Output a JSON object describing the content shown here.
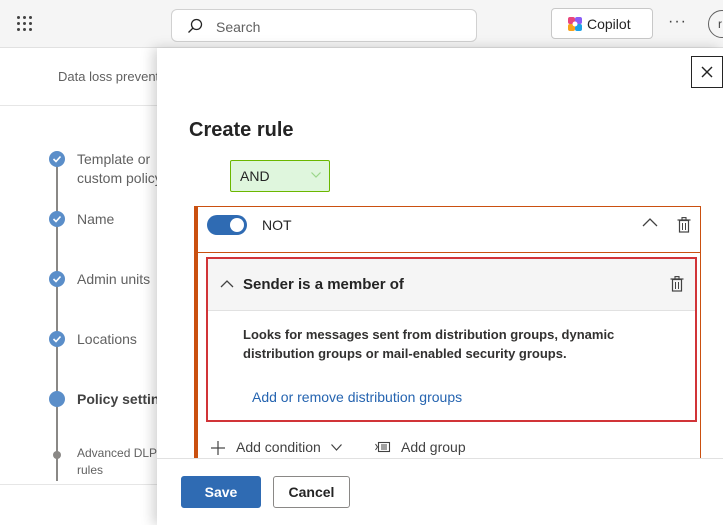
{
  "topbar": {
    "search_placeholder": "Search",
    "copilot_label": "Copilot",
    "more_label": "···",
    "avatar_initial": "r"
  },
  "background": {
    "breadcrumb": "Data loss prevention",
    "steps": [
      {
        "label": "Template or",
        "label2": "custom policy",
        "state": "done"
      },
      {
        "label": "Name",
        "state": "done"
      },
      {
        "label": "Admin units",
        "state": "done"
      },
      {
        "label": "Locations",
        "state": "done"
      },
      {
        "label": "Policy settings",
        "state": "current"
      },
      {
        "label": "Advanced DLP",
        "label2": "rules",
        "state": "sub"
      }
    ]
  },
  "panel": {
    "title": "Create rule",
    "operator": "AND",
    "group": {
      "toggle_on": true,
      "label": "NOT",
      "condition": {
        "title": "Sender is a member of",
        "description": "Looks for messages sent from distribution groups, dynamic distribution groups or mail-enabled security groups.",
        "link": "Add or remove distribution groups"
      }
    },
    "add_condition_label": "Add condition",
    "add_group_label": "Add group",
    "save_label": "Save",
    "cancel_label": "Cancel"
  },
  "colors": {
    "accent": "#2f6bb3",
    "group_border": "#ca5010",
    "condition_highlight": "#d13438",
    "and_background": "#dff6dd"
  }
}
